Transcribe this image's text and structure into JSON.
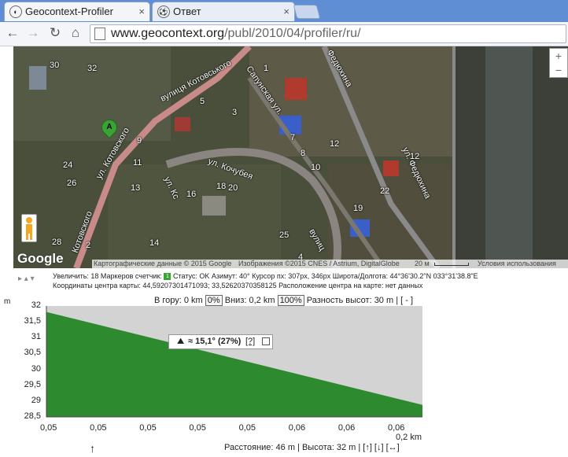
{
  "browser": {
    "tabs": [
      {
        "title": "Geocontext-Profiler",
        "icon": "geocontext-icon"
      },
      {
        "title": "Ответ",
        "icon": "soccer-ball-icon"
      }
    ],
    "close_glyph": "×",
    "nav": {
      "back": "←",
      "forward": "→",
      "reload": "↻",
      "home": "⌂"
    },
    "url_domain": "www.geocontext.org",
    "url_path": "/publ/2010/04/profiler/ru/"
  },
  "map": {
    "zoom_in": "+",
    "zoom_out": "−",
    "marker_label": "A",
    "google_logo": "Google",
    "copyright": "Картографические данные © 2015 Google",
    "imagery": "Изображения ©2015 CNES / Astrium, DigitalGlobe",
    "scale": "20 м",
    "terms": "Условия использования",
    "street_labels": [
      "вулиця Котовського",
      "Сапунская ул.",
      "Федюхина",
      "ул. Котовского",
      "ул. Кочубея",
      "ул. Кс",
      "ул. Федюхина",
      "вулиц",
      "Котовского"
    ],
    "house_numbers": [
      "30",
      "32",
      "1",
      "5",
      "3",
      "9",
      "7",
      "11",
      "13",
      "16",
      "18",
      "20",
      "14",
      "8",
      "10",
      "12",
      "24",
      "26",
      "28",
      "2",
      "22",
      "19",
      "12",
      "25",
      "4"
    ]
  },
  "info": {
    "controls": "▸ ▴ ▾",
    "line1_part1": "Увеличить: 18   Маркеров счетчик:",
    "marker_count": "1",
    "line1_part2": "  Статус: OK   Азимут: 40°   Курсор пх: 307px, 346px   Широта/Долгота: 44°36'30.2\"N 033°31'38.8\"E",
    "line2": "Координаты центра карты: 44,59207301471093; 33,52620370358125   Расположение центра на карте: нет данных"
  },
  "profile": {
    "top_uphill": "В гору: 0 km",
    "top_uphill_pct": "0%",
    "top_down": "Вниз: 0,2 km",
    "top_down_pct": "100%",
    "top_diff": "Разность высот: 30 m | [ - ]",
    "y_unit": "m",
    "tooltip_icon": "⛰",
    "tooltip_value": "≈ 15,1° (27%)",
    "tooltip_help": "[?]",
    "x_unit": "0,2 km",
    "cursor": "↑",
    "bottom": "Расстояние: 46 m | Высота: 32 m | [↑] [↓] [↔]"
  },
  "chart_data": {
    "type": "area",
    "xlabel": "km",
    "ylabel": "m",
    "ylim": [
      28.5,
      32.2
    ],
    "y_ticks": [
      "32",
      "31,5",
      "31",
      "30,5",
      "30",
      "29,5",
      "29",
      "28,5"
    ],
    "x_ticks": [
      "0,05",
      "0,05",
      "0,05",
      "0,05",
      "0,05",
      "0,06",
      "0,06",
      "0,06"
    ],
    "series": [
      {
        "x": [
          0.0,
          0.2
        ],
        "y": [
          32.0,
          28.9
        ],
        "color": "#2e8a2e"
      }
    ],
    "background": "#d3d3d3"
  }
}
